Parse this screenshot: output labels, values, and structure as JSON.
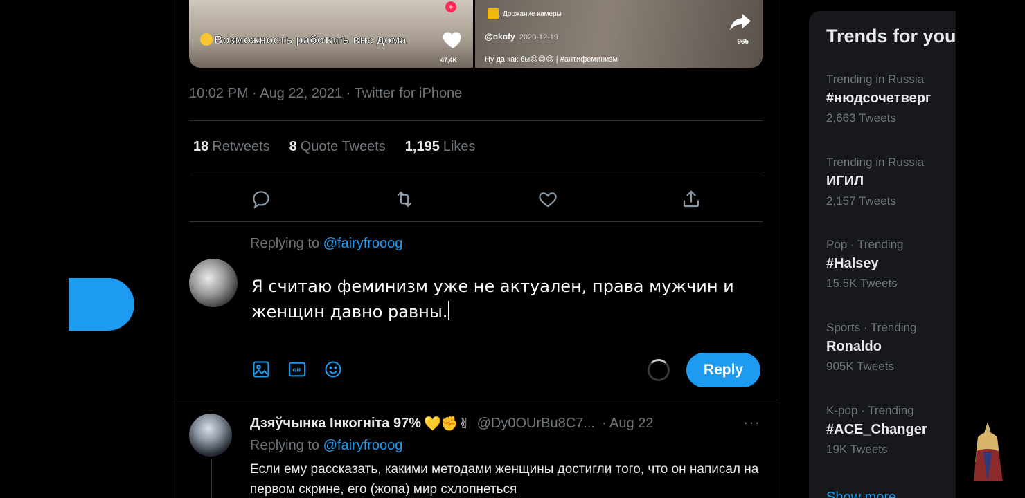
{
  "media": {
    "left_caption": "Возможность работать вне дома",
    "left_plus": "+",
    "left_like_count": "47,4K",
    "right_sound": "Дрожание камеры",
    "right_user": "@okofy",
    "right_date": "2020-12-19",
    "right_desc": "Ну да как бы😊😊😊 | #антифеминизм",
    "right_share_count": "965"
  },
  "tweet": {
    "timestamp": "10:02 PM · Aug 22, 2021 · Twitter for iPhone",
    "stats": {
      "retweets_count": "18",
      "retweets_label": "Retweets",
      "quotes_count": "8",
      "quotes_label": "Quote Tweets",
      "likes_count": "1,195",
      "likes_label": "Likes"
    },
    "actions": [
      "reply-icon",
      "retweet-icon",
      "like-icon",
      "share-icon"
    ]
  },
  "composer": {
    "replying_prefix": "Replying to",
    "replying_handle": "@fairyfrooog",
    "text": "Я считаю феминизм уже не актуален, права мужчин и женщин давно равны.",
    "tools": [
      "image-icon",
      "gif-icon",
      "emoji-icon"
    ],
    "reply_button": "Reply"
  },
  "reply_tweet": {
    "name": "Дзяўчынка Інкогніта 97%",
    "name_emoji": "💛✊✌",
    "handle": "@Dy0OUrBu8C7...",
    "date": "· Aug 22",
    "more": "···",
    "replying_prefix": "Replying to",
    "replying_handle": "@fairyfrooog",
    "body": "Если ему рассказать, какими методами женщины достигли того, что он написал на первом скрине, его (жопа) мир схлопнеться"
  },
  "trends": {
    "title": "Trends for you",
    "items": [
      {
        "meta": "Trending in Russia",
        "name": "#нюдсочетверг",
        "count": "2,663 Tweets"
      },
      {
        "meta": "Trending in Russia",
        "name": "ИГИЛ",
        "count": "2,157 Tweets"
      },
      {
        "meta": "Pop · Trending",
        "name": "#Halsey",
        "count": "15.5K Tweets"
      },
      {
        "meta": "Sports · Trending",
        "name": "Ronaldo",
        "count": "905K Tweets"
      },
      {
        "meta": "K-pop · Trending",
        "name": "#ACE_Changer",
        "count": "19K Tweets"
      }
    ],
    "show_more": "Show more"
  },
  "colors": {
    "accent": "#1d9bf0",
    "background": "#000000",
    "panel": "#16181c",
    "muted": "#71767b"
  }
}
